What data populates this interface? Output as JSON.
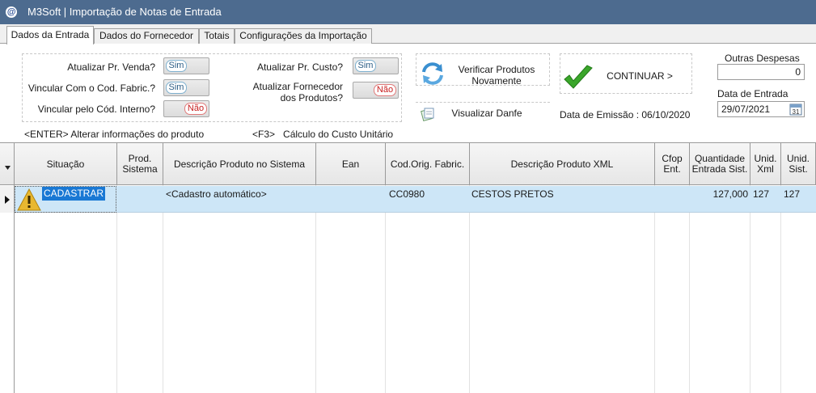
{
  "window": {
    "title": "M3Soft | Importação de Notas de Entrada"
  },
  "tabs": [
    {
      "label": "Dados da Entrada",
      "active": true
    },
    {
      "label": "Dados do Fornecedor",
      "active": false
    },
    {
      "label": "Totais",
      "active": false
    },
    {
      "label": "Configurações da Importação",
      "active": false
    }
  ],
  "options": {
    "atualizar_pr_venda": {
      "label": "Atualizar Pr. Venda?",
      "value": "Sim"
    },
    "vincular_cod_fabric": {
      "label": "Vincular Com o Cod. Fabric.?",
      "value": "Sim"
    },
    "vincular_cod_interno": {
      "label": "Vincular pelo Cód. Interno?",
      "value": "Não"
    },
    "atualizar_pr_custo": {
      "label": "Atualizar Pr. Custo?",
      "value": "Sim"
    },
    "atualizar_fornecedor": {
      "label_line1": "Atualizar Fornecedor",
      "label_line2": "dos Produtos?",
      "value": "Não"
    }
  },
  "actions": {
    "verificar_line1": "Verificar Produtos",
    "verificar_line2": "Novamente",
    "continuar": "CONTINUAR >",
    "visualizar_danfe": "Visualizar Danfe",
    "data_emissao": "Data de Emissão : 06/10/2020"
  },
  "fields": {
    "outras_despesas_label": "Outras Despesas",
    "outras_despesas_value": "0",
    "data_entrada_label": "Data de Entrada",
    "data_entrada_value": "29/07/2021",
    "calendar_day": "31"
  },
  "hints": {
    "enter": "<ENTER> Alterar informações do produto",
    "f3": "<F3>   Cálculo do Custo Unitário"
  },
  "grid": {
    "columns": [
      "Situação",
      "Prod. Sistema",
      "Descrição Produto no Sistema",
      "Ean",
      "Cod.Orig. Fabric.",
      "Descrição Produto XML",
      "Cfop Ent.",
      "Quantidade Entrada Sist.",
      "Unid. Xml",
      "Unid. Sist."
    ],
    "rows": [
      {
        "situacao": "CADASTRAR",
        "prod_sistema": "",
        "descricao_sistema": "<Cadastro automático>",
        "ean": "",
        "cod_orig_fabric": "CC0980",
        "descricao_xml": "CESTOS PRETOS",
        "cfop_ent": "",
        "quantidade": "127,000",
        "unid_xml": "127",
        "unid_sist": "127"
      }
    ]
  },
  "colors": {
    "titlebar": "#4d6b8f",
    "selected_row": "#cde6f7",
    "situacao_highlight": "#1978d4",
    "toggle_on": "#2b5d85",
    "toggle_off": "#c81e1e"
  }
}
